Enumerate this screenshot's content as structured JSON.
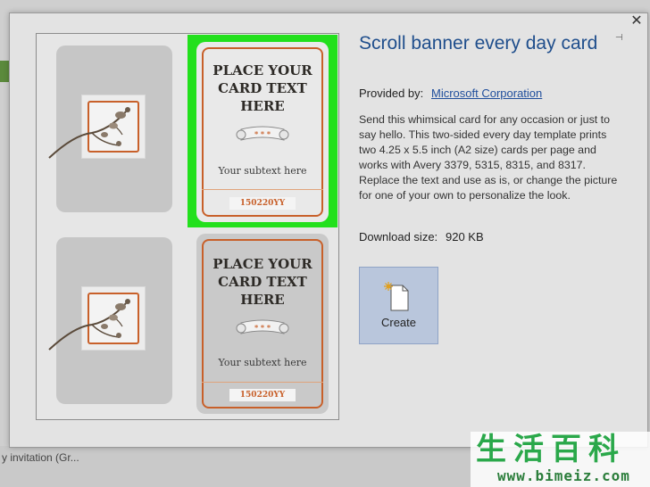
{
  "background": {
    "bottom_text": "y invitation (Gr..."
  },
  "modal": {
    "close_label": "✕",
    "pin_label": "⊣",
    "title": "Scroll banner every day card",
    "provided_by_label": "Provided by:",
    "provider": "Microsoft Corporation",
    "description": "Send this whimsical card for any occasion or just to say hello. This two-sided every day template prints two 4.25 x 5.5 inch (A2 size) cards per page and works with Avery 3379, 5315, 8315, and 8317. Replace the text and use as is, or change the picture for one of your own to personalize the look.",
    "download_size_label": "Download size:",
    "download_size_value": "920 KB",
    "create_label": "Create",
    "accent_color": "#1f4e8c",
    "selection_color": "#22e01c"
  },
  "preview": {
    "cards": [
      {
        "title": "PLACE YOUR\nCARD TEXT\nHERE",
        "subtext": "Your subtext here",
        "stars": "* * *",
        "code": "150220YY"
      },
      {
        "title": "PLACE YOUR\nCARD TEXT\nHERE",
        "subtext": "Your subtext here",
        "stars": "* * *",
        "code": "150220YY"
      }
    ]
  },
  "watermark": {
    "chars": "生活百科",
    "url": "www.bimeiz.com"
  }
}
